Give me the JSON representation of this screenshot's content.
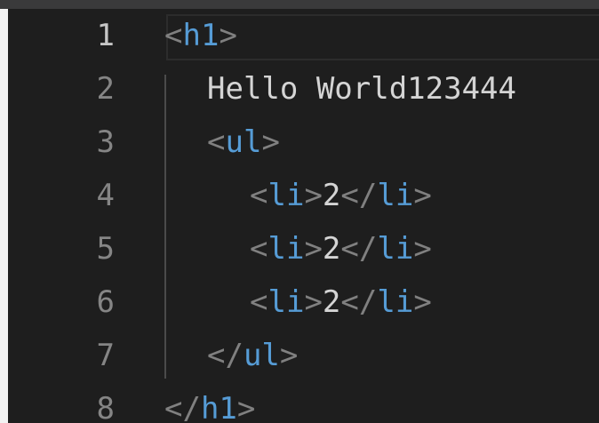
{
  "editor": {
    "active_line": 1,
    "colors": {
      "background": "#1e1e1e",
      "tag": "#569cd6",
      "punctuation": "#808080",
      "text": "#d4d4d4",
      "line_number": "#858585",
      "active_line_number": "#c6c6c6"
    },
    "lines": [
      {
        "number": "1",
        "tokens": [
          {
            "type": "punct",
            "text": "<"
          },
          {
            "type": "tag",
            "text": "h1"
          },
          {
            "type": "punct",
            "text": ">"
          }
        ]
      },
      {
        "number": "2",
        "tokens": [
          {
            "type": "text",
            "text": "Hello World123444"
          }
        ]
      },
      {
        "number": "3",
        "tokens": [
          {
            "type": "punct",
            "text": "<"
          },
          {
            "type": "tag",
            "text": "ul"
          },
          {
            "type": "punct",
            "text": ">"
          }
        ]
      },
      {
        "number": "4",
        "tokens": [
          {
            "type": "punct",
            "text": "<"
          },
          {
            "type": "tag",
            "text": "li"
          },
          {
            "type": "punct",
            "text": ">"
          },
          {
            "type": "text",
            "text": "2"
          },
          {
            "type": "punct",
            "text": "</"
          },
          {
            "type": "tag",
            "text": "li"
          },
          {
            "type": "punct",
            "text": ">"
          }
        ]
      },
      {
        "number": "5",
        "tokens": [
          {
            "type": "punct",
            "text": "<"
          },
          {
            "type": "tag",
            "text": "li"
          },
          {
            "type": "punct",
            "text": ">"
          },
          {
            "type": "text",
            "text": "2"
          },
          {
            "type": "punct",
            "text": "</"
          },
          {
            "type": "tag",
            "text": "li"
          },
          {
            "type": "punct",
            "text": ">"
          }
        ]
      },
      {
        "number": "6",
        "tokens": [
          {
            "type": "punct",
            "text": "<"
          },
          {
            "type": "tag",
            "text": "li"
          },
          {
            "type": "punct",
            "text": ">"
          },
          {
            "type": "text",
            "text": "2"
          },
          {
            "type": "punct",
            "text": "</"
          },
          {
            "type": "tag",
            "text": "li"
          },
          {
            "type": "punct",
            "text": ">"
          }
        ]
      },
      {
        "number": "7",
        "tokens": [
          {
            "type": "punct",
            "text": "</"
          },
          {
            "type": "tag",
            "text": "ul"
          },
          {
            "type": "punct",
            "text": ">"
          }
        ]
      },
      {
        "number": "8",
        "tokens": [
          {
            "type": "punct",
            "text": "</"
          },
          {
            "type": "tag",
            "text": "h1"
          },
          {
            "type": "punct",
            "text": ">"
          }
        ]
      }
    ]
  }
}
